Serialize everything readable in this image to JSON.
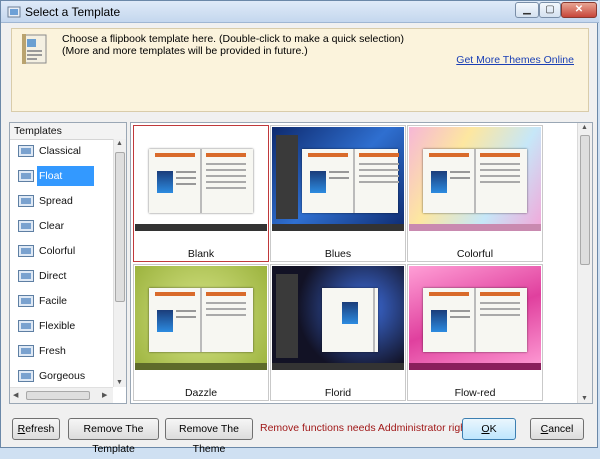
{
  "window": {
    "title": "Select a Template",
    "min_glyph": "▁",
    "max_glyph": "▢",
    "close_glyph": "✕"
  },
  "info": {
    "line1": "Choose a flipbook template here. (Double-click to make a quick selection)",
    "line2": "(More and more templates will be provided in future.)",
    "link": "Get More Themes Online"
  },
  "templates_panel": {
    "header": "Templates",
    "items": [
      {
        "label": "Classical",
        "selected": false
      },
      {
        "label": "Float",
        "selected": true
      },
      {
        "label": "Spread",
        "selected": false
      },
      {
        "label": "Clear",
        "selected": false
      },
      {
        "label": "Colorful",
        "selected": false
      },
      {
        "label": "Direct",
        "selected": false
      },
      {
        "label": "Facile",
        "selected": false
      },
      {
        "label": "Flexible",
        "selected": false
      },
      {
        "label": "Fresh",
        "selected": false
      },
      {
        "label": "Gorgeous",
        "selected": false
      }
    ]
  },
  "grid": {
    "items": [
      {
        "label": "Blank",
        "selected": true,
        "bg": "#ffffff"
      },
      {
        "label": "Blues",
        "selected": false,
        "bg": "#1a3f8f"
      },
      {
        "label": "Colorful",
        "selected": false,
        "bg": "#f3c9e4"
      },
      {
        "label": "Dazzle",
        "selected": false,
        "bg": "#b9d16a"
      },
      {
        "label": "Florid",
        "selected": false,
        "bg": "#1a1a2a"
      },
      {
        "label": "Flow-red",
        "selected": false,
        "bg": "#f06ab8"
      }
    ]
  },
  "buttons": {
    "refresh_first": "R",
    "refresh_rest": "efresh",
    "remove_template": "Remove The Template",
    "remove_theme": "Remove The Theme",
    "ok_first": "O",
    "ok_rest": "K",
    "cancel_first": "C",
    "cancel_rest": "ancel"
  },
  "warning": "Remove functions needs Addministrator rights!",
  "colors": {
    "selection": "#3399ff",
    "selected_border": "#c0393b",
    "warning": "#a01818",
    "link": "#1a3fb5"
  }
}
